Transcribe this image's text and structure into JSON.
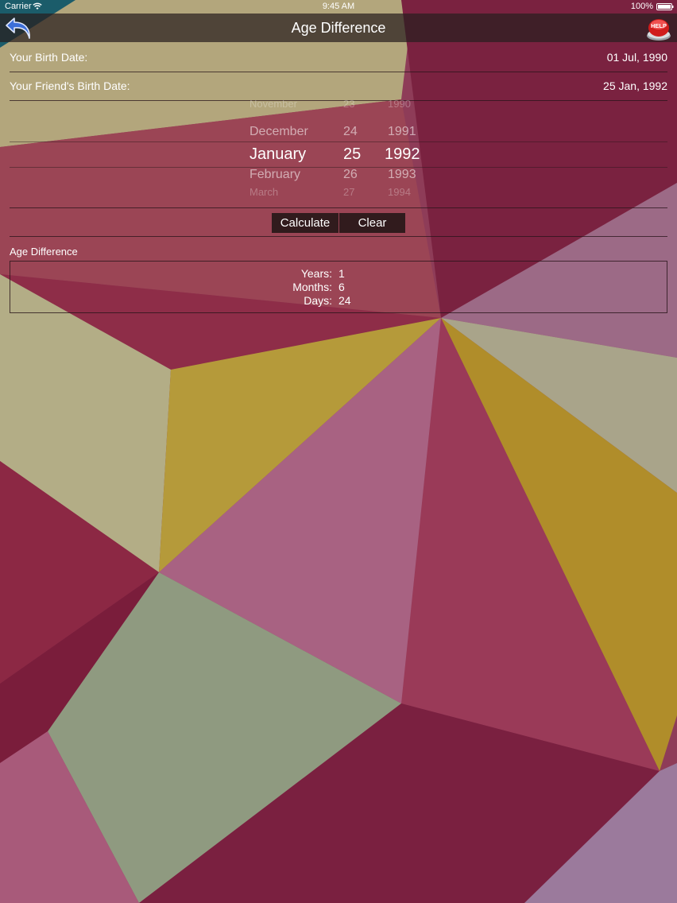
{
  "status_bar": {
    "carrier": "Carrier",
    "time": "9:45 AM",
    "battery": "100%"
  },
  "nav": {
    "title": "Age Difference",
    "back_icon": "back-arrow-icon",
    "help_label": "HELP"
  },
  "form": {
    "birth_date_label": "Your Birth Date:",
    "birth_date_value": "01 Jul, 1990",
    "friend_birth_date_label": "Your Friend's Birth Date:",
    "friend_birth_date_value": "25 Jan, 1992"
  },
  "picker": {
    "months": [
      "November",
      "December",
      "January",
      "February",
      "March"
    ],
    "days": [
      "23",
      "24",
      "25",
      "26",
      "27"
    ],
    "years": [
      "1990",
      "1991",
      "1992",
      "1993",
      "1994"
    ],
    "selected_index": 2
  },
  "buttons": {
    "calculate": "Calculate",
    "clear": "Clear"
  },
  "result": {
    "heading": "Age Difference",
    "years_label": "Years:",
    "years": "1",
    "months_label": "Months:",
    "months": "6",
    "days_label": "Days:",
    "days": "24"
  },
  "colors": {
    "navbar": "#2a1e1e",
    "button_bg": "#1e1414",
    "accent_help": "#d01c1c"
  }
}
